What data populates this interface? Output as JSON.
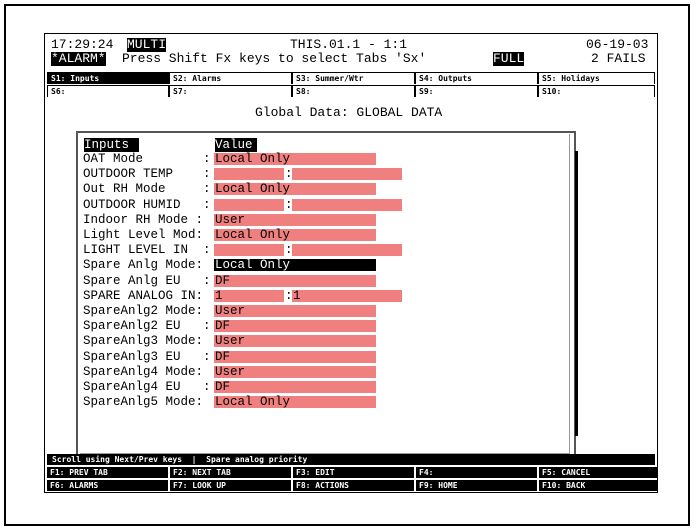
{
  "header": {
    "time": "17:29:24",
    "mode": "MULTI",
    "location": "THIS.01.1 - 1:1",
    "date": "06-19-03",
    "alarm": "*ALARM*",
    "prompt": "Press Shift Fx keys to select Tabs 'Sx'",
    "full": "FULL",
    "fails": "2 FAILS"
  },
  "tabs_row1": [
    "S1: Inputs",
    "S2: Alarms",
    "S3: Summer/Wtr",
    "S4: Outputs",
    "S5: Holidays"
  ],
  "tabs_row2": [
    "S6:",
    "S7:",
    "S8:",
    "S9:",
    "S10:"
  ],
  "title": "Global Data: GLOBAL DATA",
  "table": {
    "col_inputs": "Inputs",
    "col_value": "Value",
    "rows": [
      {
        "label": "OAT Mode        :",
        "value": "Local Only"
      },
      {
        "label": "OUTDOOR TEMP    :",
        "value": "",
        "value2": ""
      },
      {
        "label": "Out RH Mode     :",
        "value": "Local Only"
      },
      {
        "label": "OUTDOOR HUMID   :",
        "value": "",
        "value2": ""
      },
      {
        "label": "Indoor RH Mode :",
        "value": "User"
      },
      {
        "label": "Light Level Mod:",
        "value": "Local Only"
      },
      {
        "label": "LIGHT LEVEL IN  :",
        "value": "",
        "value2": ""
      },
      {
        "label": "Spare Anlg Mode:",
        "value": "Local Only",
        "selected": true
      },
      {
        "label": "Spare Anlg EU   :",
        "value": "DF"
      },
      {
        "label": "SPARE ANALOG IN:",
        "value": "1",
        "value2": "1"
      },
      {
        "label": "SpareAnlg2 Mode:",
        "value": "User"
      },
      {
        "label": "SpareAnlg2 EU   :",
        "value": "DF"
      },
      {
        "label": "SpareAnlg3 Mode:",
        "value": "User"
      },
      {
        "label": "SpareAnlg3 EU   :",
        "value": "DF"
      },
      {
        "label": "SpareAnlg4 Mode:",
        "value": "User"
      },
      {
        "label": "SpareAnlg4 EU   :",
        "value": "DF"
      },
      {
        "label": "SpareAnlg5 Mode:",
        "value": "Local Only"
      }
    ]
  },
  "status": "Scroll using Next/Prev keys  |  Spare analog priority",
  "fkeys_row1": [
    "F1: PREV TAB",
    "F2: NEXT TAB",
    "F3: EDIT",
    "F4:",
    "F5: CANCEL"
  ],
  "fkeys_row2": [
    "F6: ALARMS",
    "F7: LOOK UP",
    "F8: ACTIONS",
    "F9: HOME",
    "F10: BACK"
  ],
  "colors": {
    "value_bg": "#f08080",
    "inverse": "#000000"
  }
}
